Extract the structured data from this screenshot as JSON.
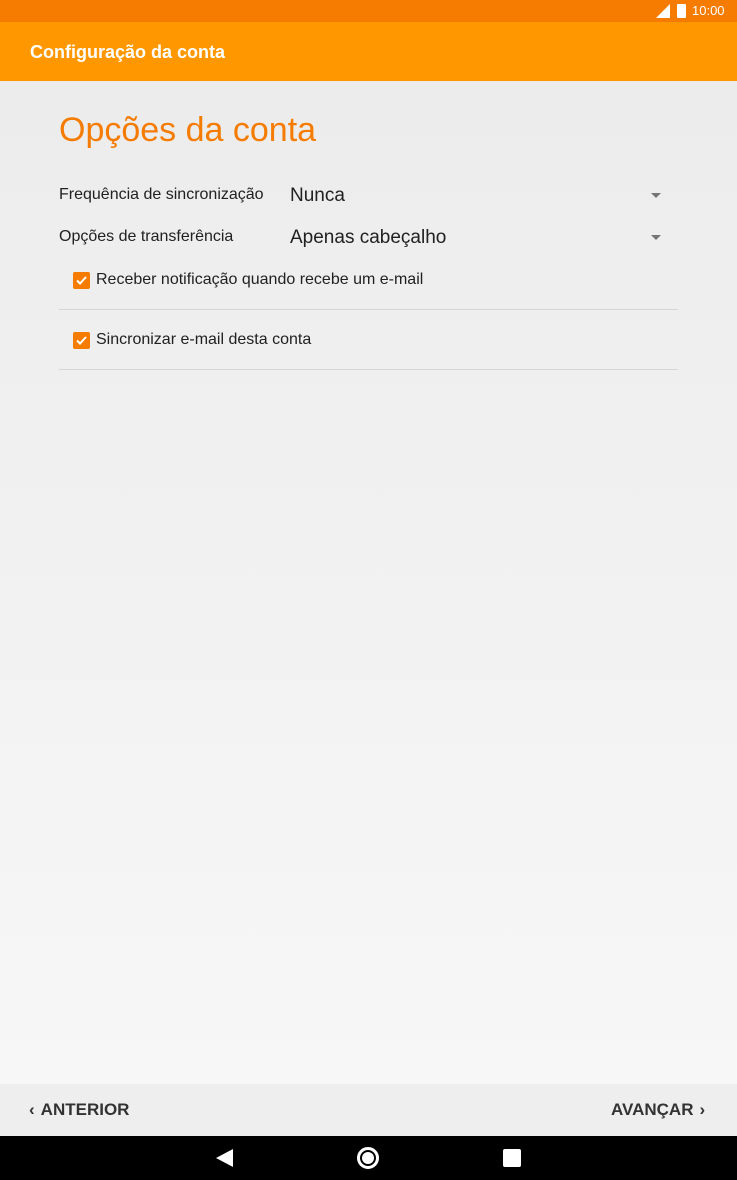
{
  "status_bar": {
    "time": "10:00"
  },
  "app_bar": {
    "title": "Configuração da conta"
  },
  "page": {
    "title": "Opções da conta",
    "settings": [
      {
        "label": "Frequência de sincronização",
        "value": "Nunca"
      },
      {
        "label": "Opções de transferência",
        "value": "Apenas cabeçalho"
      }
    ],
    "checkboxes": [
      {
        "label": "Receber notificação quando recebe um e-mail",
        "checked": true
      },
      {
        "label": "Sincronizar e-mail desta conta",
        "checked": true
      }
    ]
  },
  "footer": {
    "previous": "ANTERIOR",
    "next": "AVANÇAR"
  },
  "colors": {
    "accent": "#f57c00",
    "app_bar": "#ff9800",
    "status_bar": "#f57c00"
  }
}
